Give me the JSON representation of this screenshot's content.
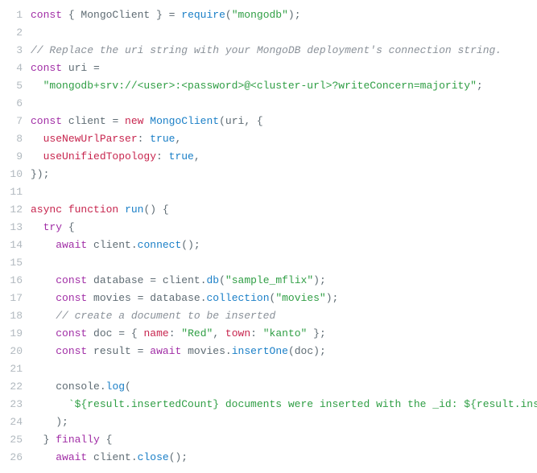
{
  "lines": [
    {
      "num": "1",
      "tokens": [
        [
          "kw",
          "const"
        ],
        [
          "p",
          " { "
        ],
        [
          "id",
          "MongoClient"
        ],
        [
          "p",
          " } = "
        ],
        [
          "fn",
          "require"
        ],
        [
          "p",
          "("
        ],
        [
          "str",
          "\"mongodb\""
        ],
        [
          "p",
          ");"
        ]
      ]
    },
    {
      "num": "2",
      "tokens": []
    },
    {
      "num": "3",
      "tokens": [
        [
          "comm",
          "// Replace the uri string with your MongoDB deployment's connection string."
        ]
      ]
    },
    {
      "num": "4",
      "tokens": [
        [
          "kw",
          "const"
        ],
        [
          "p",
          " "
        ],
        [
          "id",
          "uri"
        ],
        [
          "p",
          " ="
        ]
      ]
    },
    {
      "num": "5",
      "tokens": [
        [
          "p",
          "  "
        ],
        [
          "str",
          "\"mongodb+srv://<user>:<password>@<cluster-url>?writeConcern=majority\""
        ],
        [
          "p",
          ";"
        ]
      ]
    },
    {
      "num": "6",
      "tokens": []
    },
    {
      "num": "7",
      "tokens": [
        [
          "kw",
          "const"
        ],
        [
          "p",
          " "
        ],
        [
          "id",
          "client"
        ],
        [
          "p",
          " = "
        ],
        [
          "kw2",
          "new"
        ],
        [
          "p",
          " "
        ],
        [
          "fn",
          "MongoClient"
        ],
        [
          "p",
          "("
        ],
        [
          "id",
          "uri"
        ],
        [
          "p",
          ", {"
        ]
      ]
    },
    {
      "num": "8",
      "tokens": [
        [
          "p",
          "  "
        ],
        [
          "prop",
          "useNewUrlParser"
        ],
        [
          "p",
          ": "
        ],
        [
          "bool",
          "true"
        ],
        [
          "p",
          ","
        ]
      ]
    },
    {
      "num": "9",
      "tokens": [
        [
          "p",
          "  "
        ],
        [
          "prop",
          "useUnifiedTopology"
        ],
        [
          "p",
          ": "
        ],
        [
          "bool",
          "true"
        ],
        [
          "p",
          ","
        ]
      ]
    },
    {
      "num": "10",
      "tokens": [
        [
          "p",
          "});"
        ]
      ]
    },
    {
      "num": "11",
      "tokens": []
    },
    {
      "num": "12",
      "tokens": [
        [
          "kw2",
          "async"
        ],
        [
          "p",
          " "
        ],
        [
          "kw2",
          "function"
        ],
        [
          "p",
          " "
        ],
        [
          "fn",
          "run"
        ],
        [
          "p",
          "() {"
        ]
      ]
    },
    {
      "num": "13",
      "tokens": [
        [
          "p",
          "  "
        ],
        [
          "kw",
          "try"
        ],
        [
          "p",
          " {"
        ]
      ]
    },
    {
      "num": "14",
      "tokens": [
        [
          "p",
          "    "
        ],
        [
          "kw",
          "await"
        ],
        [
          "p",
          " "
        ],
        [
          "id",
          "client"
        ],
        [
          "p",
          "."
        ],
        [
          "fn",
          "connect"
        ],
        [
          "p",
          "();"
        ]
      ]
    },
    {
      "num": "15",
      "tokens": []
    },
    {
      "num": "16",
      "tokens": [
        [
          "p",
          "    "
        ],
        [
          "kw",
          "const"
        ],
        [
          "p",
          " "
        ],
        [
          "id",
          "database"
        ],
        [
          "p",
          " = "
        ],
        [
          "id",
          "client"
        ],
        [
          "p",
          "."
        ],
        [
          "fn",
          "db"
        ],
        [
          "p",
          "("
        ],
        [
          "str",
          "\"sample_mflix\""
        ],
        [
          "p",
          ");"
        ]
      ]
    },
    {
      "num": "17",
      "tokens": [
        [
          "p",
          "    "
        ],
        [
          "kw",
          "const"
        ],
        [
          "p",
          " "
        ],
        [
          "id",
          "movies"
        ],
        [
          "p",
          " = "
        ],
        [
          "id",
          "database"
        ],
        [
          "p",
          "."
        ],
        [
          "fn",
          "collection"
        ],
        [
          "p",
          "("
        ],
        [
          "str",
          "\"movies\""
        ],
        [
          "p",
          ");"
        ]
      ]
    },
    {
      "num": "18",
      "tokens": [
        [
          "p",
          "    "
        ],
        [
          "comm",
          "// create a document to be inserted"
        ]
      ]
    },
    {
      "num": "19",
      "tokens": [
        [
          "p",
          "    "
        ],
        [
          "kw",
          "const"
        ],
        [
          "p",
          " "
        ],
        [
          "id",
          "doc"
        ],
        [
          "p",
          " = { "
        ],
        [
          "prop",
          "name"
        ],
        [
          "p",
          ": "
        ],
        [
          "str",
          "\"Red\""
        ],
        [
          "p",
          ", "
        ],
        [
          "prop",
          "town"
        ],
        [
          "p",
          ": "
        ],
        [
          "str",
          "\"kanto\""
        ],
        [
          "p",
          " };"
        ]
      ]
    },
    {
      "num": "20",
      "tokens": [
        [
          "p",
          "    "
        ],
        [
          "kw",
          "const"
        ],
        [
          "p",
          " "
        ],
        [
          "id",
          "result"
        ],
        [
          "p",
          " = "
        ],
        [
          "kw",
          "await"
        ],
        [
          "p",
          " "
        ],
        [
          "id",
          "movies"
        ],
        [
          "p",
          "."
        ],
        [
          "fn",
          "insertOne"
        ],
        [
          "p",
          "("
        ],
        [
          "id",
          "doc"
        ],
        [
          "p",
          ");"
        ]
      ]
    },
    {
      "num": "21",
      "tokens": []
    },
    {
      "num": "22",
      "tokens": [
        [
          "p",
          "    "
        ],
        [
          "id",
          "console"
        ],
        [
          "p",
          "."
        ],
        [
          "fn",
          "log"
        ],
        [
          "p",
          "("
        ]
      ]
    },
    {
      "num": "23",
      "tokens": [
        [
          "p",
          "      "
        ],
        [
          "str",
          "`${result.insertedCount} documents were inserted with the _id: ${result.insertedId}"
        ]
      ]
    },
    {
      "num": "24",
      "tokens": [
        [
          "p",
          "    );"
        ]
      ]
    },
    {
      "num": "25",
      "tokens": [
        [
          "p",
          "  } "
        ],
        [
          "kw",
          "finally"
        ],
        [
          "p",
          " {"
        ]
      ]
    },
    {
      "num": "26",
      "tokens": [
        [
          "p",
          "    "
        ],
        [
          "kw",
          "await"
        ],
        [
          "p",
          " "
        ],
        [
          "id",
          "client"
        ],
        [
          "p",
          "."
        ],
        [
          "fn",
          "close"
        ],
        [
          "p",
          "();"
        ]
      ]
    }
  ]
}
